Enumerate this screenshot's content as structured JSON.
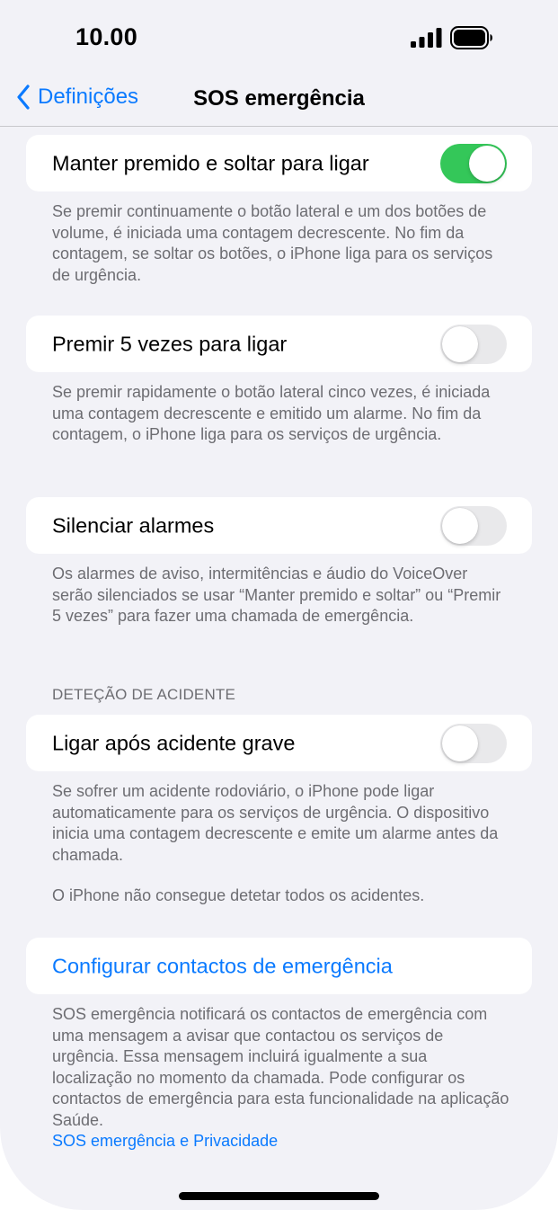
{
  "status_bar": {
    "time": "10.00"
  },
  "nav": {
    "back_label": "Definições",
    "title": "SOS emergência"
  },
  "rows": [
    {
      "label": "Manter premido e soltar para ligar",
      "toggle_on": true,
      "footer": "Se premir continuamente o botão lateral e um dos botões de volume, é iniciada uma contagem decrescente. No fim da contagem, se soltar os botões, o iPhone liga para os serviços de urgência."
    },
    {
      "label": "Premir 5 vezes para ligar",
      "toggle_on": false,
      "footer": "Se premir rapidamente o botão lateral cinco vezes, é iniciada uma contagem decrescente e emitido um alarme. No fim da contagem, o iPhone liga para os serviços de urgência."
    },
    {
      "label": "Silenciar alarmes",
      "toggle_on": false,
      "footer": "Os alarmes de aviso, intermitências e áudio do VoiceOver serão silenciados se usar “Manter premido e soltar” ou “Premir 5 vezes” para fazer uma chamada de emergência."
    }
  ],
  "crash_detection": {
    "header": "DETEÇÃO DE ACIDENTE",
    "label": "Ligar após acidente grave",
    "toggle_on": false,
    "footer_1": "Se sofrer um acidente rodoviário, o iPhone pode ligar automaticamente para os serviços de urgência. O dispositivo inicia uma contagem decrescente e emite um alarme antes da chamada.",
    "footer_2": "O iPhone não consegue detetar todos os acidentes."
  },
  "contacts": {
    "label": "Configurar contactos de emergência",
    "footer": "SOS emergência notificará os contactos de emergência com uma mensagem a avisar que contactou os serviços de urgência. Essa mensagem incluirá igualmente a sua localização no momento da chamada. Pode configurar os contactos de emergência para esta funcionalidade na aplicação Saúde.",
    "privacy_link": "SOS emergência e Privacidade"
  },
  "colors": {
    "accent": "#0a7aff",
    "toggle_on": "#34c759",
    "toggle_off": "#e9e9eb",
    "background": "#f2f2f7",
    "footer_text": "#6d6d72"
  }
}
